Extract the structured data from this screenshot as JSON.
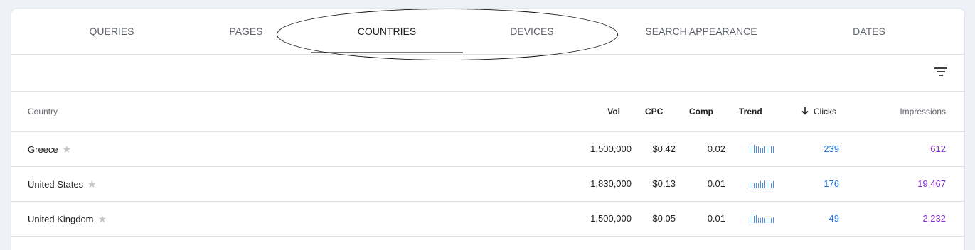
{
  "tabs": [
    {
      "label": "QUERIES"
    },
    {
      "label": "PAGES"
    },
    {
      "label": "COUNTRIES"
    },
    {
      "label": "DEVICES"
    },
    {
      "label": "SEARCH APPEARANCE"
    },
    {
      "label": "DATES"
    }
  ],
  "active_tab": "COUNTRIES",
  "columns": {
    "country": "Country",
    "vol": "Vol",
    "cpc": "CPC",
    "comp": "Comp",
    "trend": "Trend",
    "clicks": "Clicks",
    "impressions": "Impressions"
  },
  "sort_icon": "arrow-down-icon",
  "filter_icon": "filter-icon",
  "colors": {
    "clicks": "#1a73e8",
    "impressions": "#8430ce",
    "trend": "#4a8fe7"
  },
  "rows": [
    {
      "country": "Greece",
      "vol": "1,500,000",
      "cpc": "$0.42",
      "comp": "0.02",
      "clicks": "239",
      "impressions": "612",
      "trend": [
        0.8,
        0.9,
        1.0,
        0.8,
        0.8,
        0.7,
        0.7,
        0.8,
        0.8,
        0.7,
        0.8,
        0.8
      ]
    },
    {
      "country": "United States",
      "vol": "1,830,000",
      "cpc": "$0.13",
      "comp": "0.01",
      "clicks": "176",
      "impressions": "19,467",
      "trend": [
        0.6,
        0.7,
        0.6,
        0.7,
        0.6,
        0.8,
        0.7,
        0.9,
        0.7,
        1.0,
        0.6,
        0.8
      ]
    },
    {
      "country": "United Kingdom",
      "vol": "1,500,000",
      "cpc": "$0.05",
      "comp": "0.01",
      "clicks": "49",
      "impressions": "2,232",
      "trend": [
        0.7,
        1.0,
        0.8,
        0.9,
        0.6,
        0.6,
        0.7,
        0.6,
        0.6,
        0.6,
        0.6,
        0.7
      ]
    }
  ]
}
